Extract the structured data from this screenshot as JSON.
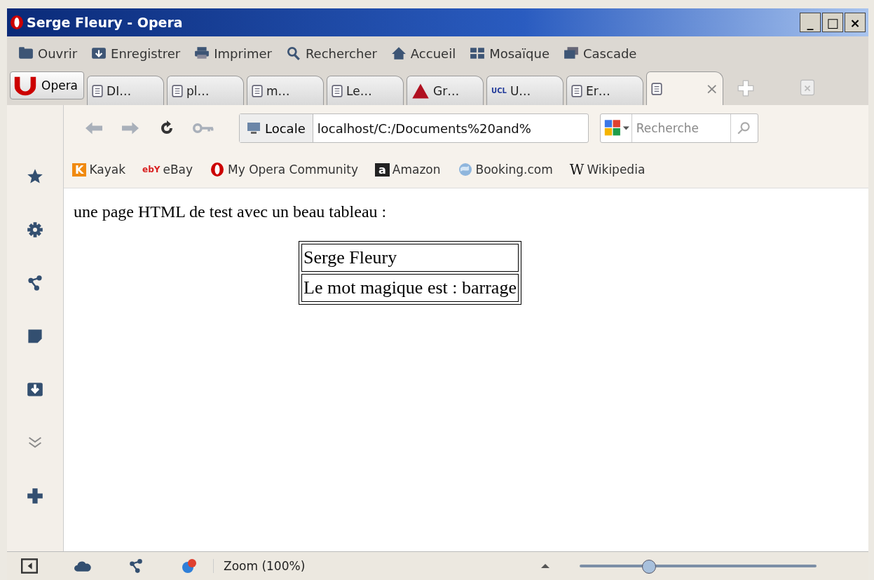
{
  "window": {
    "title": "Serge Fleury - Opera",
    "controls": [
      "_",
      "□",
      "×"
    ]
  },
  "menu": [
    {
      "label": "Ouvrir",
      "kind": "folder"
    },
    {
      "label": "Enregistrer",
      "kind": "save"
    },
    {
      "label": "Imprimer",
      "kind": "print"
    },
    {
      "label": "Rechercher",
      "kind": "search"
    },
    {
      "label": "Accueil",
      "kind": "home"
    },
    {
      "label": "Mosaïque",
      "kind": "tile"
    },
    {
      "label": "Cascade",
      "kind": "cascade"
    }
  ],
  "opera_button": {
    "label": "Opera"
  },
  "tabs": [
    {
      "label": "DI…",
      "kind": "page",
      "selected": false
    },
    {
      "label": "pl…",
      "kind": "page",
      "selected": false
    },
    {
      "label": "m…",
      "kind": "page",
      "selected": false
    },
    {
      "label": "Le…",
      "kind": "page",
      "selected": false
    },
    {
      "label": "Gr…",
      "kind": "triangle",
      "selected": false
    },
    {
      "label": "U…",
      "kind": "ucl",
      "badge": "UCL",
      "selected": false
    },
    {
      "label": "Er…",
      "kind": "page",
      "selected": false
    },
    {
      "kind": "page",
      "selected": true,
      "close": "×"
    }
  ],
  "address": {
    "badge": "Locale",
    "value": "localhost/C:/Documents%20and%",
    "search_placeholder": "Recherche"
  },
  "bookmarks": [
    {
      "label": "Kayak",
      "kind": "kayak",
      "mark": "K"
    },
    {
      "label": "eBay",
      "kind": "ebay",
      "mark": "ebY"
    },
    {
      "label": "My Opera Community",
      "kind": "opera"
    },
    {
      "label": "Amazon",
      "kind": "amazon",
      "mark": "a"
    },
    {
      "label": "Booking.com",
      "kind": "globe"
    },
    {
      "label": "Wikipedia",
      "kind": "wiki",
      "mark": "W"
    }
  ],
  "sidebar": [
    {
      "kind": "star"
    },
    {
      "kind": "gear"
    },
    {
      "kind": "share"
    },
    {
      "kind": "note"
    },
    {
      "kind": "download"
    },
    {
      "kind": "more"
    },
    {
      "kind": "add"
    }
  ],
  "content": {
    "text": "une page HTML de test avec un beau tableau :",
    "table": [
      [
        "Serge Fleury"
      ],
      [
        "Le mot magique est : barrage"
      ]
    ]
  },
  "status_bar": {
    "text": "Zoom (100%)",
    "zoom": {
      "level": 0.29
    }
  }
}
